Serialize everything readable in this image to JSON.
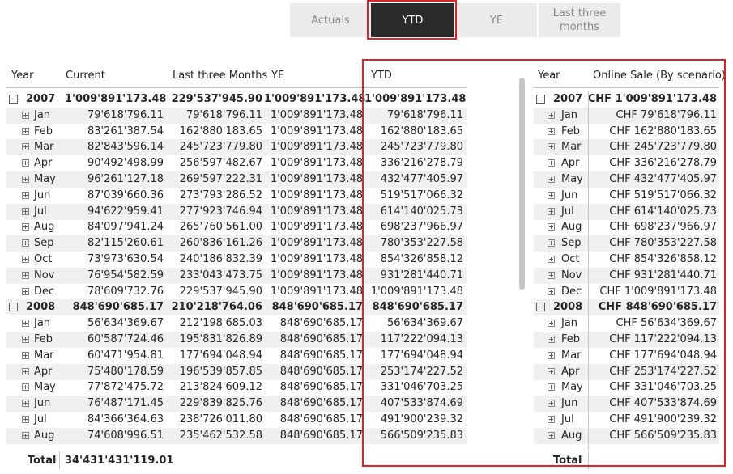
{
  "slicer": {
    "options": [
      "Actuals",
      "YTD",
      "YE",
      "Last three months"
    ],
    "selected": "YTD"
  },
  "left_table": {
    "columns": [
      "Year",
      "Current",
      "Last three Months",
      "YE",
      "YTD"
    ],
    "rows": [
      {
        "label": "2007",
        "level": 0,
        "current": "1'009'891'173.48",
        "last3": "229'537'945.90",
        "ye": "1'009'891'173.48",
        "ytd": "1'009'891'173.48"
      },
      {
        "label": "Jan",
        "level": 1,
        "current": "79'618'796.11",
        "last3": "79'618'796.11",
        "ye": "1'009'891'173.48",
        "ytd": "79'618'796.11"
      },
      {
        "label": "Feb",
        "level": 1,
        "current": "83'261'387.54",
        "last3": "162'880'183.65",
        "ye": "1'009'891'173.48",
        "ytd": "162'880'183.65"
      },
      {
        "label": "Mar",
        "level": 1,
        "current": "82'843'596.14",
        "last3": "245'723'779.80",
        "ye": "1'009'891'173.48",
        "ytd": "245'723'779.80"
      },
      {
        "label": "Apr",
        "level": 1,
        "current": "90'492'498.99",
        "last3": "256'597'482.67",
        "ye": "1'009'891'173.48",
        "ytd": "336'216'278.79"
      },
      {
        "label": "May",
        "level": 1,
        "current": "96'261'127.18",
        "last3": "269'597'222.31",
        "ye": "1'009'891'173.48",
        "ytd": "432'477'405.97"
      },
      {
        "label": "Jun",
        "level": 1,
        "current": "87'039'660.36",
        "last3": "273'793'286.52",
        "ye": "1'009'891'173.48",
        "ytd": "519'517'066.32"
      },
      {
        "label": "Jul",
        "level": 1,
        "current": "94'622'959.41",
        "last3": "277'923'746.94",
        "ye": "1'009'891'173.48",
        "ytd": "614'140'025.73"
      },
      {
        "label": "Aug",
        "level": 1,
        "current": "84'097'941.24",
        "last3": "265'760'561.00",
        "ye": "1'009'891'173.48",
        "ytd": "698'237'966.97"
      },
      {
        "label": "Sep",
        "level": 1,
        "current": "82'115'260.61",
        "last3": "260'836'161.26",
        "ye": "1'009'891'173.48",
        "ytd": "780'353'227.58"
      },
      {
        "label": "Oct",
        "level": 1,
        "current": "73'973'630.54",
        "last3": "240'186'832.39",
        "ye": "1'009'891'173.48",
        "ytd": "854'326'858.12"
      },
      {
        "label": "Nov",
        "level": 1,
        "current": "76'954'582.59",
        "last3": "233'043'473.75",
        "ye": "1'009'891'173.48",
        "ytd": "931'281'440.71"
      },
      {
        "label": "Dec",
        "level": 1,
        "current": "78'609'732.76",
        "last3": "229'537'945.90",
        "ye": "1'009'891'173.48",
        "ytd": "1'009'891'173.48"
      },
      {
        "label": "2008",
        "level": 0,
        "current": "848'690'685.17",
        "last3": "210'218'764.06",
        "ye": "848'690'685.17",
        "ytd": "848'690'685.17"
      },
      {
        "label": "Jan",
        "level": 1,
        "current": "56'634'369.67",
        "last3": "212'198'685.03",
        "ye": "848'690'685.17",
        "ytd": "56'634'369.67"
      },
      {
        "label": "Feb",
        "level": 1,
        "current": "60'587'724.46",
        "last3": "195'831'826.89",
        "ye": "848'690'685.17",
        "ytd": "117'222'094.13"
      },
      {
        "label": "Mar",
        "level": 1,
        "current": "60'471'954.81",
        "last3": "177'694'048.94",
        "ye": "848'690'685.17",
        "ytd": "177'694'048.94"
      },
      {
        "label": "Apr",
        "level": 1,
        "current": "75'480'178.59",
        "last3": "196'539'857.85",
        "ye": "848'690'685.17",
        "ytd": "253'174'227.52"
      },
      {
        "label": "May",
        "level": 1,
        "current": "77'872'475.72",
        "last3": "213'824'609.12",
        "ye": "848'690'685.17",
        "ytd": "331'046'703.25"
      },
      {
        "label": "Jun",
        "level": 1,
        "current": "76'487'171.45",
        "last3": "229'839'825.76",
        "ye": "848'690'685.17",
        "ytd": "407'533'874.69"
      },
      {
        "label": "Jul",
        "level": 1,
        "current": "84'366'364.63",
        "last3": "238'726'011.80",
        "ye": "848'690'685.17",
        "ytd": "491'900'239.32"
      },
      {
        "label": "Aug",
        "level": 1,
        "current": "74'608'996.51",
        "last3": "235'462'532.58",
        "ye": "848'690'685.17",
        "ytd": "566'509'235.83"
      }
    ],
    "total_label": "Total",
    "total_current": "34'431'431'119.01"
  },
  "right_table": {
    "columns": [
      "Year",
      "Online Sale (By scenario)"
    ],
    "rows": [
      {
        "label": "2007",
        "level": 0,
        "value": "CHF 1'009'891'173.48"
      },
      {
        "label": "Jan",
        "level": 1,
        "value": "CHF 79'618'796.11"
      },
      {
        "label": "Feb",
        "level": 1,
        "value": "CHF 162'880'183.65"
      },
      {
        "label": "Mar",
        "level": 1,
        "value": "CHF 245'723'779.80"
      },
      {
        "label": "Apr",
        "level": 1,
        "value": "CHF 336'216'278.79"
      },
      {
        "label": "May",
        "level": 1,
        "value": "CHF 432'477'405.97"
      },
      {
        "label": "Jun",
        "level": 1,
        "value": "CHF 519'517'066.32"
      },
      {
        "label": "Jul",
        "level": 1,
        "value": "CHF 614'140'025.73"
      },
      {
        "label": "Aug",
        "level": 1,
        "value": "CHF 698'237'966.97"
      },
      {
        "label": "Sep",
        "level": 1,
        "value": "CHF 780'353'227.58"
      },
      {
        "label": "Oct",
        "level": 1,
        "value": "CHF 854'326'858.12"
      },
      {
        "label": "Nov",
        "level": 1,
        "value": "CHF 931'281'440.71"
      },
      {
        "label": "Dec",
        "level": 1,
        "value": "CHF 1'009'891'173.48"
      },
      {
        "label": "2008",
        "level": 0,
        "value": "CHF 848'690'685.17"
      },
      {
        "label": "Jan",
        "level": 1,
        "value": "CHF 56'634'369.67"
      },
      {
        "label": "Feb",
        "level": 1,
        "value": "CHF 117'222'094.13"
      },
      {
        "label": "Mar",
        "level": 1,
        "value": "CHF 177'694'048.94"
      },
      {
        "label": "Apr",
        "level": 1,
        "value": "CHF 253'174'227.52"
      },
      {
        "label": "May",
        "level": 1,
        "value": "CHF 331'046'703.25"
      },
      {
        "label": "Jun",
        "level": 1,
        "value": "CHF 407'533'874.69"
      },
      {
        "label": "Jul",
        "level": 1,
        "value": "CHF 491'900'239.32"
      },
      {
        "label": "Aug",
        "level": 1,
        "value": "CHF 566'509'235.83"
      }
    ],
    "total_label": "Total"
  },
  "colors": {
    "highlight": "#d9252a",
    "selected_button": "#2b2b2b",
    "button_bg": "#ebebeb",
    "row_shade": "#f0f0f0"
  }
}
